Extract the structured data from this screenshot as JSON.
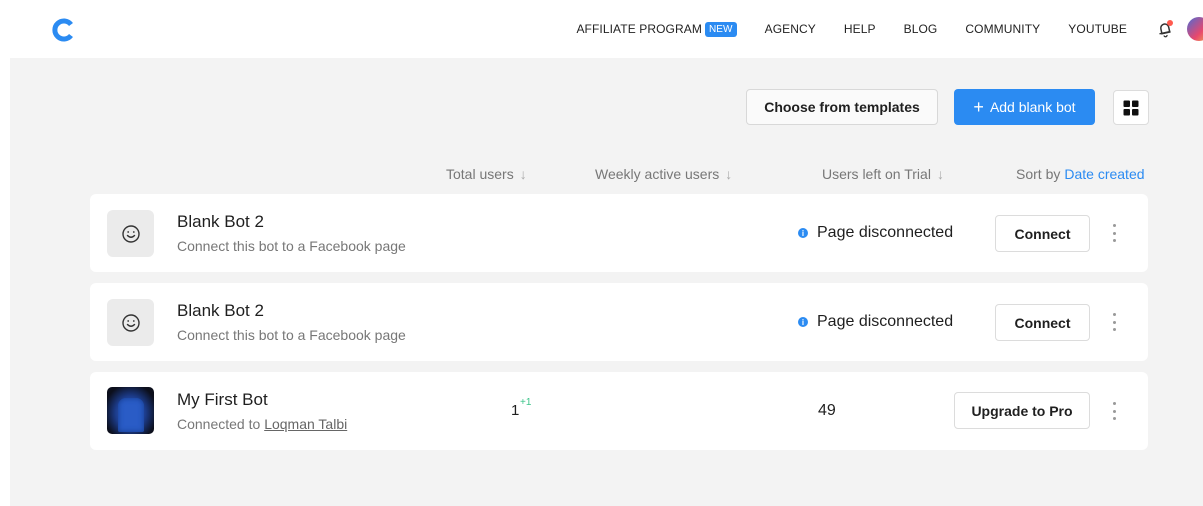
{
  "nav": {
    "items": [
      "AFFILIATE PROGRAM",
      "AGENCY",
      "HELP",
      "BLOG",
      "COMMUNITY",
      "YOUTUBE"
    ],
    "new_badge": "NEW"
  },
  "toolbar": {
    "templates_label": "Choose from templates",
    "add_plus": "+",
    "add_label": "Add blank bot"
  },
  "columns": {
    "total_users": "Total users",
    "weekly_active": "Weekly active users",
    "users_left_trial": "Users left on Trial",
    "sort_by": "Sort by",
    "sort_value": "Date created",
    "arrow": "↓"
  },
  "bots": [
    {
      "name": "Blank Bot 2",
      "subtitle": "Connect this bot to a Facebook page",
      "status": "Page disconnected",
      "action": "Connect"
    },
    {
      "name": "Blank Bot 2",
      "subtitle": "Connect this bot to a Facebook page",
      "status": "Page disconnected",
      "action": "Connect"
    },
    {
      "name": "My First Bot",
      "subtitle_prefix": "Connected to",
      "subtitle_link": "Loqman Talbi",
      "total_users": "1",
      "total_users_delta": "+1",
      "users_left_trial": "49",
      "action": "Upgrade to Pro"
    }
  ],
  "colors": {
    "accent": "#2b8bf2",
    "positive": "#3cc48a",
    "notification_dot": "#ff5a4f"
  },
  "icons": {
    "logo": "chatfuel-c-logo",
    "bell": "bell-icon",
    "grid": "grid-view-icon",
    "smiley": "smiley-icon",
    "info": "info-icon",
    "kebab": "kebab-menu-icon"
  }
}
